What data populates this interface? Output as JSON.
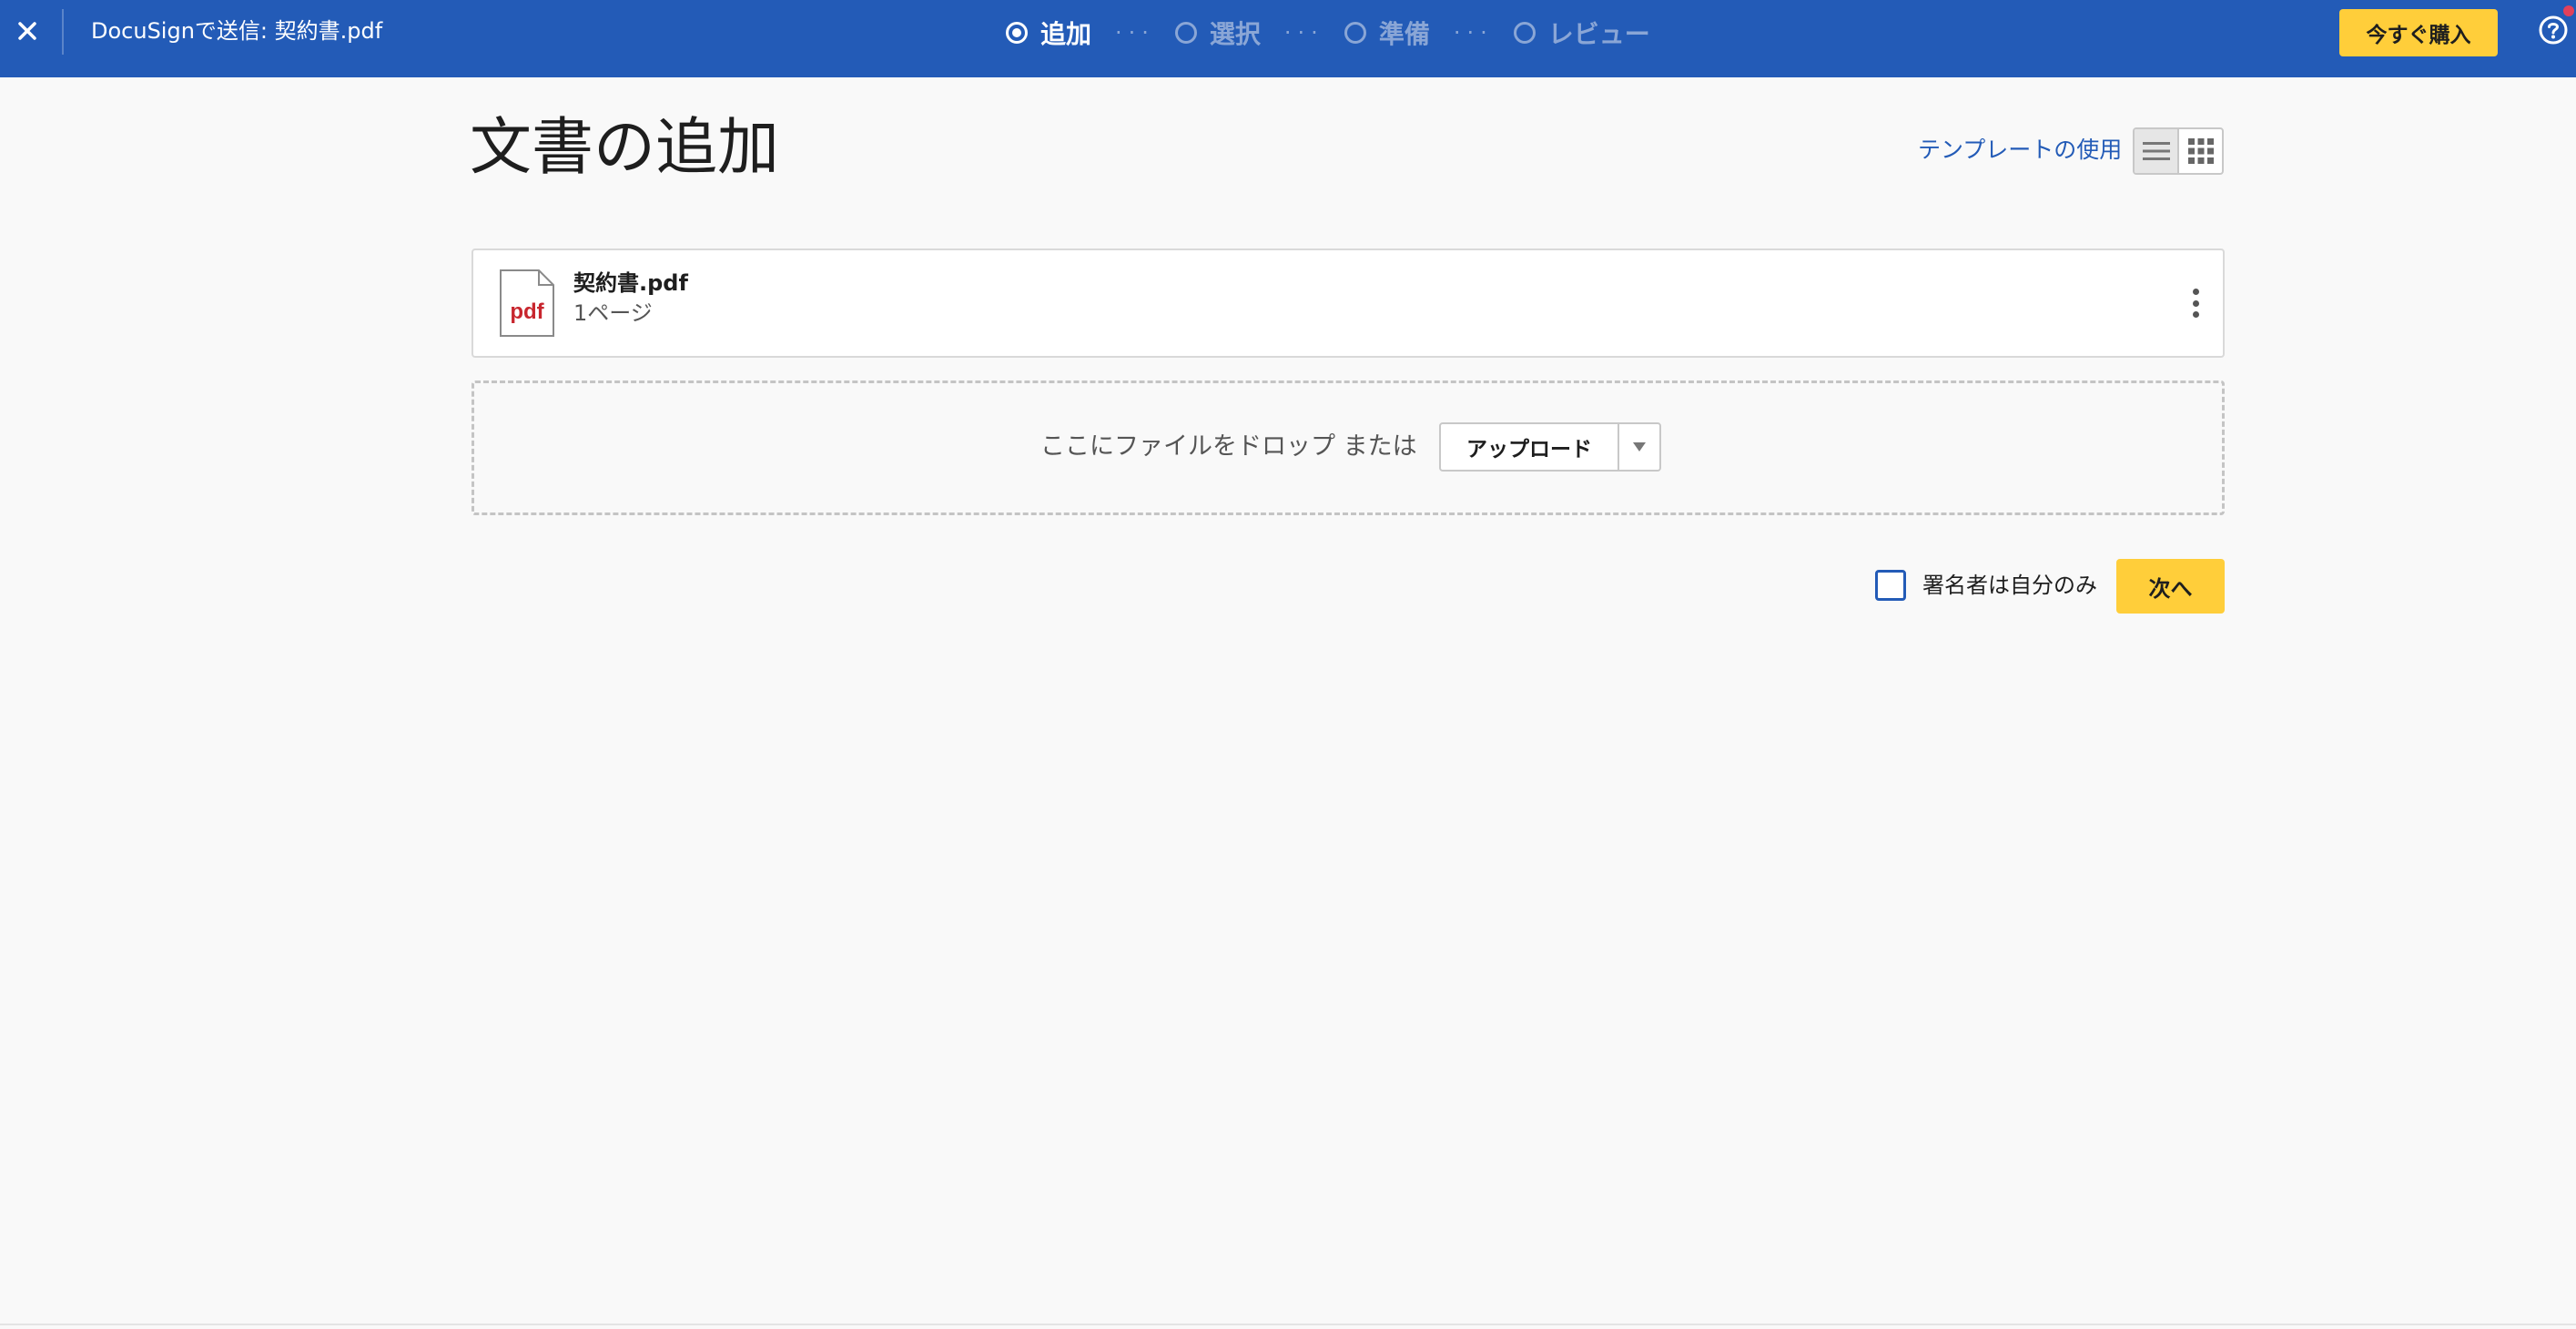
{
  "topbar": {
    "close_icon": "close-icon",
    "title": "DocuSignで送信: 契約書.pdf",
    "steps": [
      {
        "label": "追加",
        "state": "active"
      },
      {
        "label": "選択",
        "state": "inactive"
      },
      {
        "label": "準備",
        "state": "inactive"
      },
      {
        "label": "レビュー",
        "state": "inactive"
      }
    ],
    "step_separator": "···",
    "buy_label": "今すぐ購入",
    "help_icon": "help-icon",
    "colors": {
      "bar": "#235bb7",
      "buy_button": "#ffce3a",
      "notification_dot": "#e2405b"
    }
  },
  "main": {
    "title": "文書の追加",
    "template_link": "テンプレートの使用",
    "view_toggle": {
      "options": [
        "list-view-icon",
        "grid-view-icon"
      ],
      "selected": "list-view-icon"
    },
    "documents": [
      {
        "name": "契約書.pdf",
        "pages": "1ページ",
        "icon": "pdf-file-icon",
        "icon_text": "pdf"
      }
    ],
    "drop_zone": {
      "text": "ここにファイルをドロップ または",
      "upload_label": "アップロード"
    },
    "only_signer": {
      "label": "署名者は自分のみ",
      "checked": false
    },
    "next_label": "次へ"
  }
}
